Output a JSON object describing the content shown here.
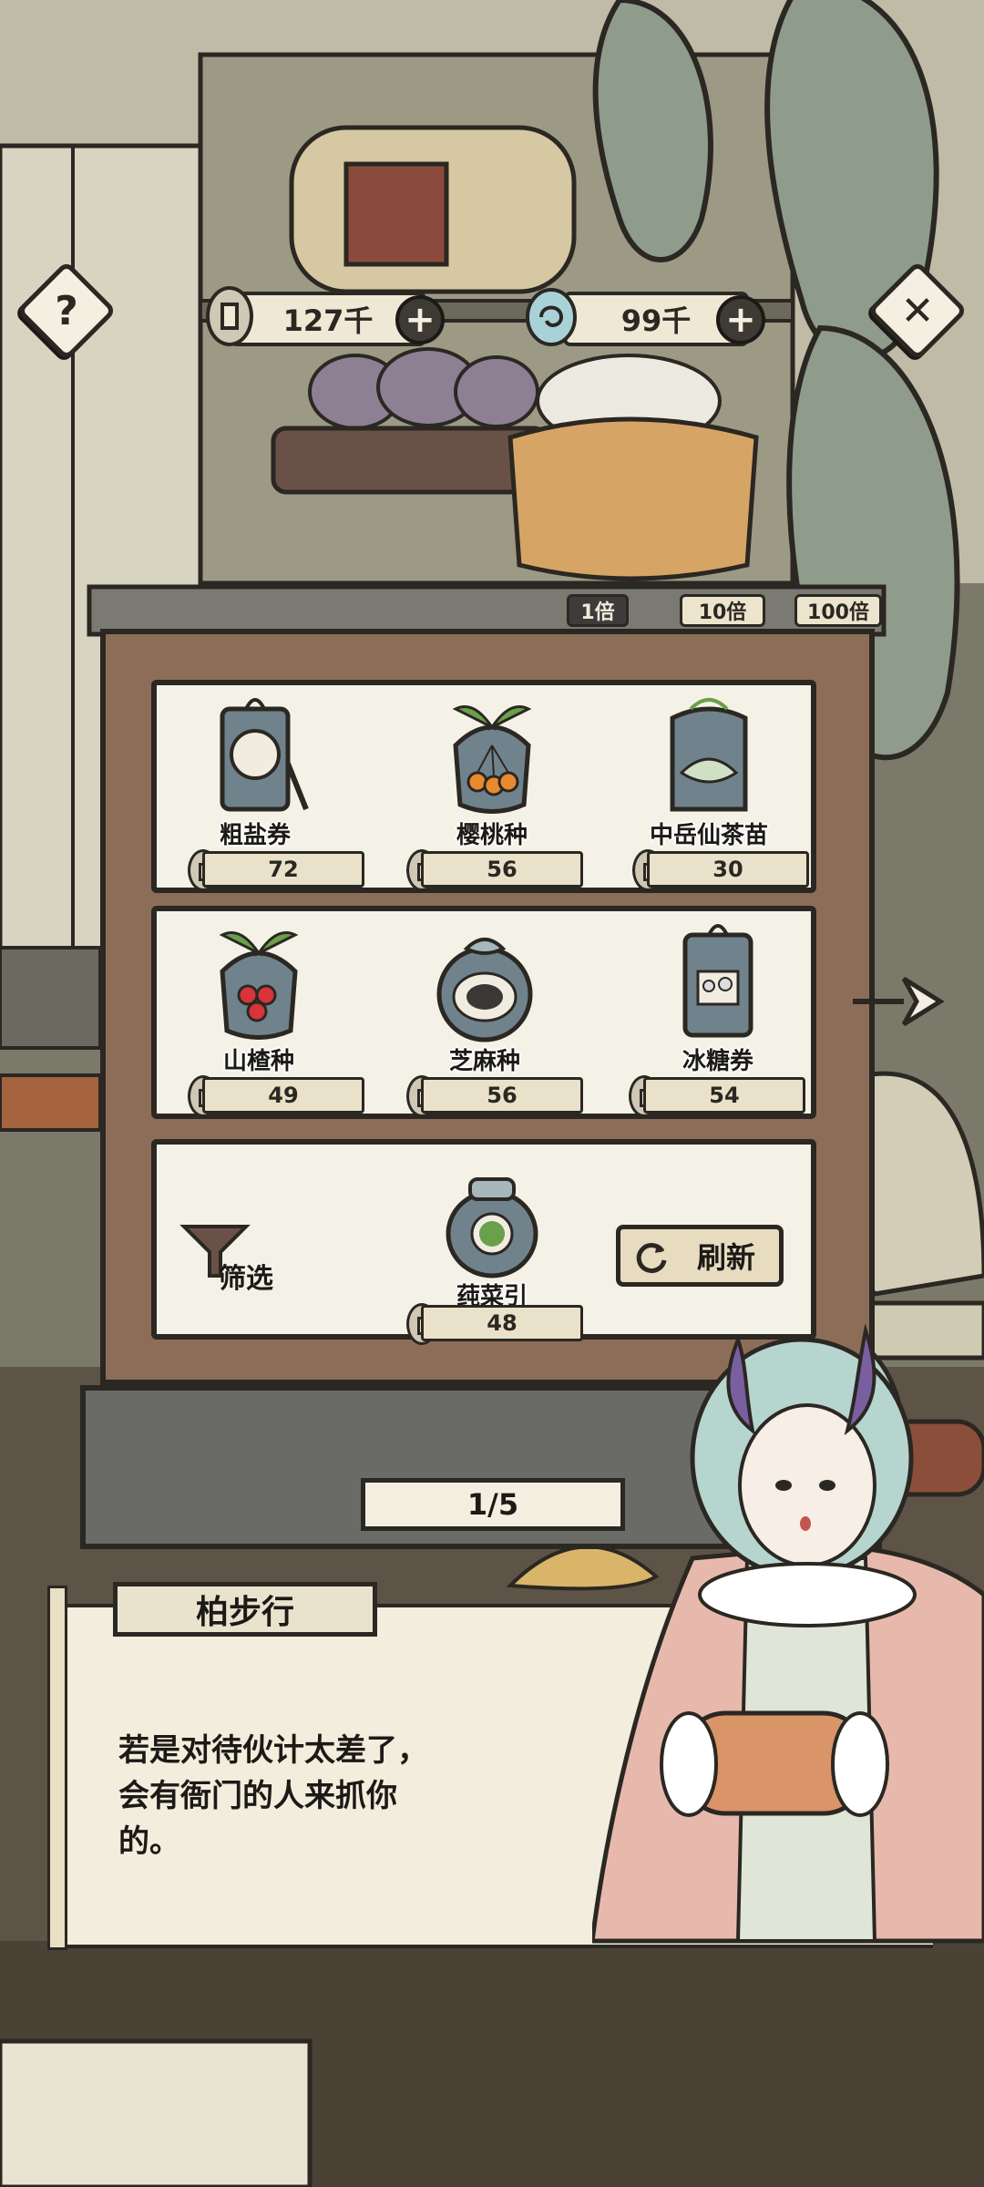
{
  "hud": {
    "help_icon": "question-icon",
    "close_icon": "close-x-icon",
    "copper_amount": "127千",
    "jade_amount": "99千"
  },
  "multipliers": [
    {
      "label": "1倍",
      "active": true
    },
    {
      "label": "10倍",
      "active": false
    },
    {
      "label": "100倍",
      "active": false
    }
  ],
  "shop_items": [
    {
      "name": "粗盐券",
      "price": "72",
      "icon": "salt-ticket-icon"
    },
    {
      "name": "樱桃种",
      "price": "56",
      "icon": "cherry-seed-icon"
    },
    {
      "name": "中岳仙茶苗",
      "price": "30",
      "icon": "tea-sapling-icon"
    },
    {
      "name": "山楂种",
      "price": "49",
      "icon": "hawthorn-seed-icon"
    },
    {
      "name": "芝麻种",
      "price": "56",
      "icon": "sesame-seed-icon"
    },
    {
      "name": "冰糖券",
      "price": "54",
      "icon": "rock-sugar-ticket-icon"
    },
    {
      "name": "莼菜引",
      "price": "48",
      "icon": "water-shield-icon"
    }
  ],
  "controls": {
    "filter_label": "筛选",
    "refresh_label": "刷新",
    "page": "1/5"
  },
  "dialog": {
    "speaker": "柏步行",
    "text": "若是对待伙计太差了，\n 会有衙门的人来抓你\n 的。"
  },
  "colors": {
    "ink": "#2b2722",
    "paper": "#f4f1e6",
    "cabinet": "#8c6d58",
    "active_tab": "#3d3c3b"
  }
}
